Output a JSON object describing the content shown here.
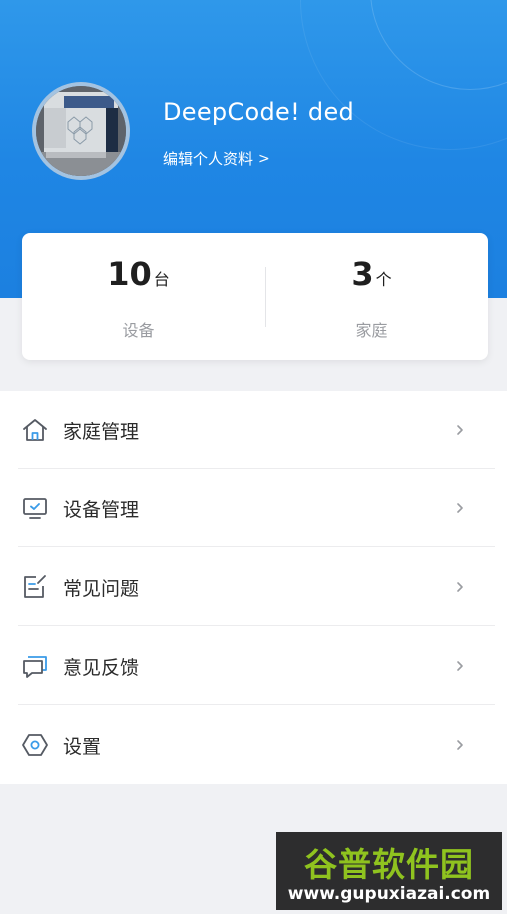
{
  "profile": {
    "username": "DeepCode!  ded",
    "edit_link_label": "编辑个人资料",
    "edit_link_chevron": ">"
  },
  "stats": [
    {
      "value": "10",
      "unit": "台",
      "label": "设备"
    },
    {
      "value": "3",
      "unit": "个",
      "label": "家庭"
    }
  ],
  "menu": {
    "items": [
      {
        "label": "家庭管理",
        "icon": "home-icon"
      },
      {
        "label": "设备管理",
        "icon": "monitor-icon"
      },
      {
        "label": "常见问题",
        "icon": "faq-note-icon"
      },
      {
        "label": "意见反馈",
        "icon": "chat-bubble-icon"
      },
      {
        "label": "设置",
        "icon": "settings-hexagon-icon"
      }
    ]
  },
  "watermark": {
    "title": "谷普软件园",
    "url": "www.gupuxiazai.com"
  },
  "colors": {
    "header_blue": "#1f86e4",
    "icon_stroke": "#555a63",
    "icon_accent": "#3a9be8",
    "chevron": "#9a9ca1",
    "watermark_green": "#8fc31f"
  }
}
